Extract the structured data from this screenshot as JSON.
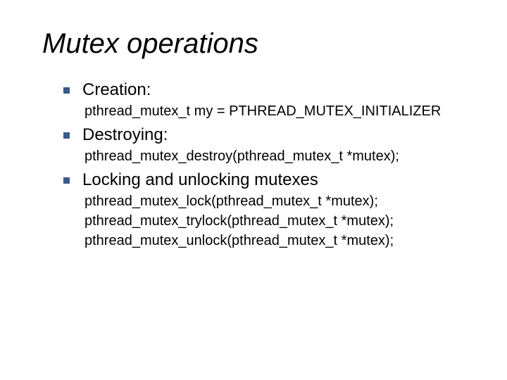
{
  "title": "Mutex operations",
  "items": [
    {
      "label": "Creation:",
      "sub": [
        "pthread_mutex_t my = PTHREAD_MUTEX_INITIALIZER"
      ]
    },
    {
      "label": "Destroying:",
      "sub": [
        "pthread_mutex_destroy(pthread_mutex_t *mutex);"
      ]
    },
    {
      "label": "Locking and unlocking mutexes",
      "sub": [
        "pthread_mutex_lock(pthread_mutex_t *mutex);",
        "pthread_mutex_trylock(pthread_mutex_t *mutex);",
        "pthread_mutex_unlock(pthread_mutex_t *mutex);"
      ]
    }
  ]
}
